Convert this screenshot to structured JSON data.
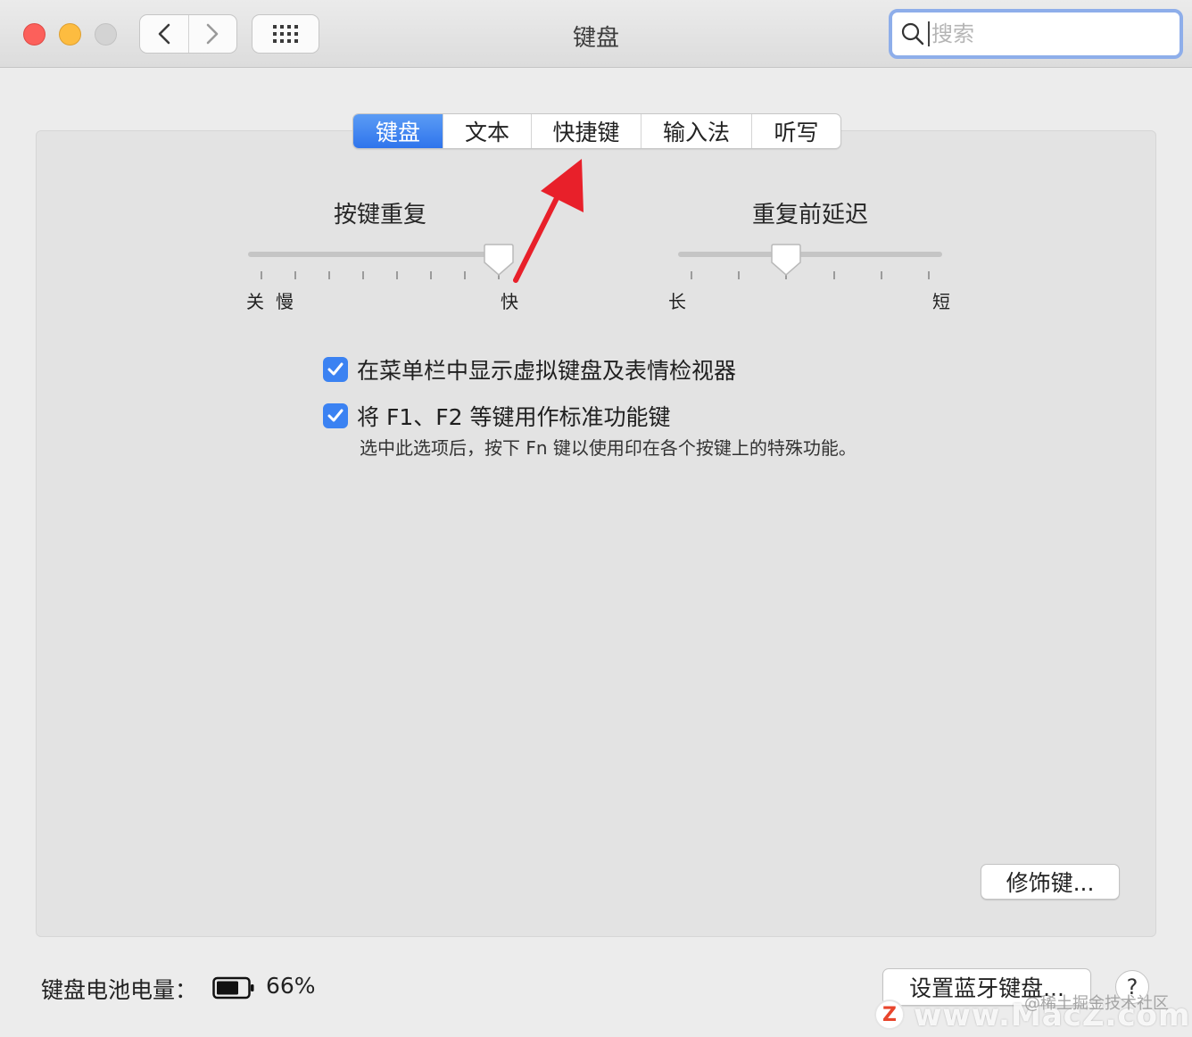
{
  "window": {
    "title": "键盘"
  },
  "search": {
    "placeholder": "搜索"
  },
  "tabs": [
    {
      "label": "键盘",
      "active": true
    },
    {
      "label": "文本",
      "active": false
    },
    {
      "label": "快捷键",
      "active": false
    },
    {
      "label": "输入法",
      "active": false
    },
    {
      "label": "听写",
      "active": false
    }
  ],
  "key_repeat": {
    "title": "按键重复",
    "labels": {
      "off": "关",
      "slow": "慢",
      "fast": "快"
    },
    "value_tick": 7,
    "tick_count": 8
  },
  "delay_until_repeat": {
    "title": "重复前延迟",
    "labels": {
      "long": "长",
      "short": "短"
    },
    "value_tick": 2,
    "tick_count": 6
  },
  "options": {
    "show_viewer": {
      "label": "在菜单栏中显示虚拟键盘及表情检视器",
      "checked": true
    },
    "fn_keys": {
      "label": "将 F1、F2 等键用作标准功能键",
      "checked": true
    },
    "fn_hint": "选中此选项后，按下 Fn 键以使用印在各个按键上的特殊功能。"
  },
  "buttons": {
    "modifier": "修饰键...",
    "bluetooth": "设置蓝牙键盘...",
    "help": "?"
  },
  "battery": {
    "label": "键盘电池电量：",
    "percent": "66%",
    "level": 0.66
  },
  "watermark": {
    "juejin": "@稀土掘金技术社区",
    "site": "www.MacZ.com",
    "logo": "Z"
  },
  "colors": {
    "accent": "#3b82f2",
    "close": "#fc605b",
    "minimize": "#fdbc40",
    "arrow": "#e8202a"
  }
}
